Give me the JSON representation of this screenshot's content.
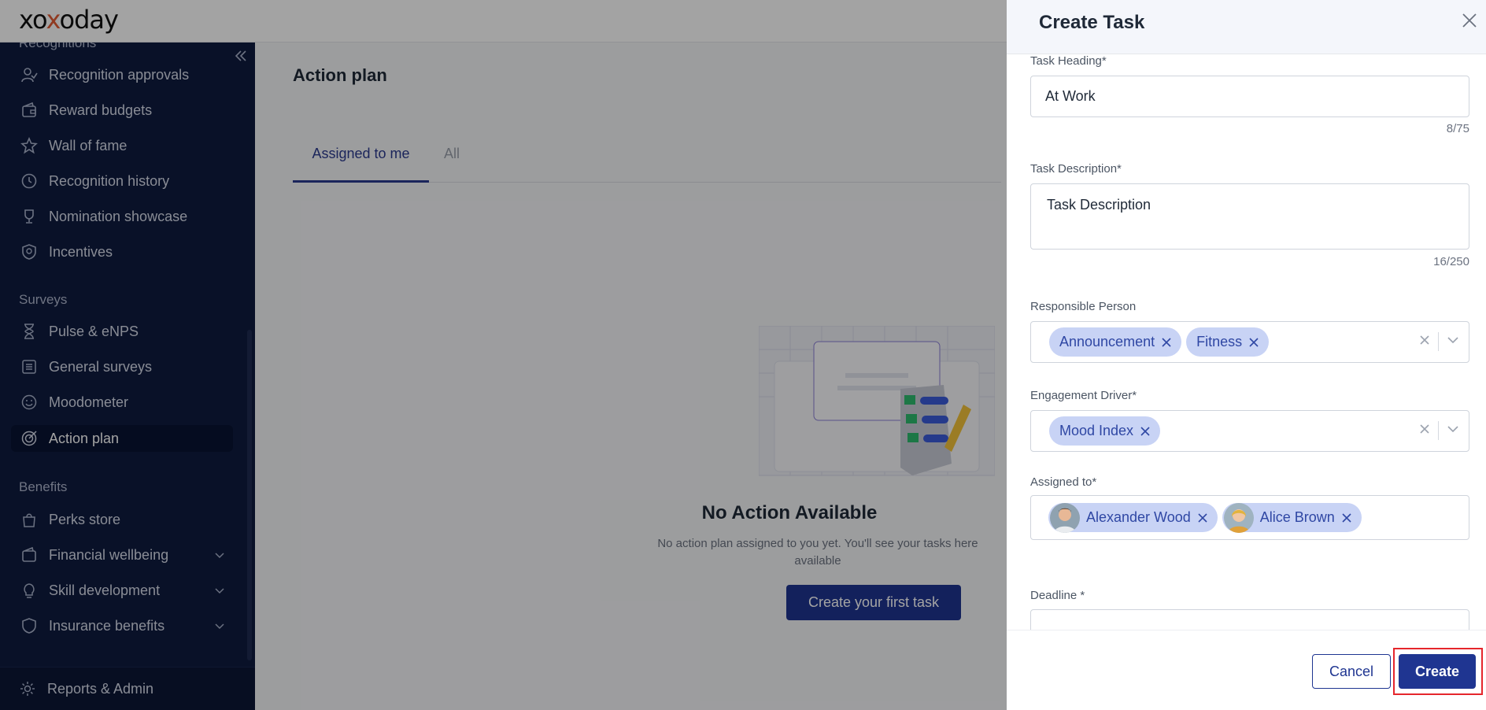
{
  "app": {
    "logo_text_1": "xo",
    "logo_text_x": "x",
    "logo_text_2": "oday"
  },
  "sidebar": {
    "partial_header": "Recognitions",
    "items_recognition": [
      {
        "label": "Recognition approvals",
        "icon": "person-check-icon"
      },
      {
        "label": "Reward budgets",
        "icon": "wallet-icon"
      },
      {
        "label": "Wall of fame",
        "icon": "star-icon"
      },
      {
        "label": "Recognition history",
        "icon": "history-icon"
      },
      {
        "label": "Nomination showcase",
        "icon": "trophy-icon"
      },
      {
        "label": "Incentives",
        "icon": "badge-icon"
      }
    ],
    "surveys_header": "Surveys",
    "items_surveys": [
      {
        "label": "Pulse & eNPS",
        "icon": "hourglass-icon"
      },
      {
        "label": "General surveys",
        "icon": "list-icon"
      },
      {
        "label": "Moodometer",
        "icon": "smiley-icon"
      },
      {
        "label": "Action plan",
        "icon": "target-icon",
        "active": true
      }
    ],
    "benefits_header": "Benefits",
    "items_benefits": [
      {
        "label": "Perks store",
        "icon": "bag-icon"
      },
      {
        "label": "Financial wellbeing",
        "icon": "wallet-icon"
      },
      {
        "label": "Skill development",
        "icon": "lightbulb-icon"
      },
      {
        "label": "Insurance benefits",
        "icon": "shield-icon"
      }
    ],
    "reports_label": "Reports & Admin"
  },
  "main": {
    "title": "Action plan",
    "tabs": [
      {
        "label": "Assigned to me",
        "active": true
      },
      {
        "label": "All"
      }
    ],
    "empty_title": "No Action Available",
    "empty_desc_line1": "No action plan assigned to you yet. You'll see your tasks here",
    "empty_desc_line2": "available",
    "cta": "Create your first task"
  },
  "drawer": {
    "title": "Create Task",
    "task_heading": {
      "label": "Task Heading*",
      "value": "At Work",
      "counter": "8/75"
    },
    "task_description": {
      "label": "Task Description*",
      "value": "Task Description",
      "counter": "16/250"
    },
    "responsible_person": {
      "label": "Responsible Person",
      "chips": [
        "Announcement",
        "Fitness"
      ]
    },
    "engagement_driver": {
      "label": "Engagement Driver*",
      "chips": [
        "Mood Index"
      ]
    },
    "assigned_to": {
      "label": "Assigned to*",
      "chips": [
        "Alexander Wood",
        "Alice Brown"
      ]
    },
    "deadline": {
      "label": "Deadline *"
    },
    "cancel": "Cancel",
    "create": "Create"
  },
  "colors": {
    "sidebar_bg": "#0f1c3f",
    "primary": "#1f3591",
    "chip_bg": "#c8d3f5",
    "chip_text": "#2f47a4",
    "highlight": "#e5262c"
  }
}
